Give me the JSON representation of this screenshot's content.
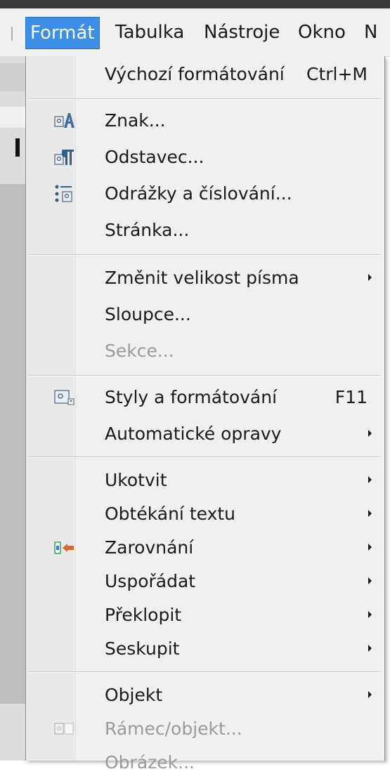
{
  "menubar": {
    "items": [
      {
        "label": "Formát",
        "active": true
      },
      {
        "label": "Tabulka"
      },
      {
        "label": "Nástroje"
      },
      {
        "label": "Okno"
      },
      {
        "label": "N"
      }
    ]
  },
  "menu": {
    "items": [
      {
        "label": "Výchozí formátování",
        "shortcut": "Ctrl+M"
      },
      {
        "label": "Znak...",
        "icon": "character-format-icon"
      },
      {
        "label": "Odstavec...",
        "icon": "paragraph-format-icon"
      },
      {
        "label": "Odrážky a číslování...",
        "icon": "bullets-numbering-icon"
      },
      {
        "label": "Stránka..."
      },
      {
        "label": "Změnit velikost písma",
        "submenu": true
      },
      {
        "label": "Sloupce..."
      },
      {
        "label": "Sekce...",
        "disabled": true
      },
      {
        "label": "Styly a formátování",
        "shortcut": "F11",
        "icon": "styles-formatting-icon"
      },
      {
        "label": "Automatické opravy",
        "submenu": true
      },
      {
        "label": "Ukotvit",
        "submenu": true
      },
      {
        "label": "Obtékání textu",
        "submenu": true
      },
      {
        "label": "Zarovnání",
        "submenu": true,
        "icon": "alignment-icon"
      },
      {
        "label": "Uspořádat",
        "submenu": true
      },
      {
        "label": "Překlopit",
        "submenu": true
      },
      {
        "label": "Seskupit",
        "submenu": true
      },
      {
        "label": "Objekt",
        "submenu": true
      },
      {
        "label": "Rámec/objekt...",
        "disabled": true,
        "icon": "frame-object-icon"
      },
      {
        "label": "Obrázek...",
        "disabled": true
      }
    ]
  },
  "colors": {
    "highlight": "#3c8ee6",
    "menu_bg": "#f0f0f0",
    "disabled_text": "#9a9a9a"
  }
}
